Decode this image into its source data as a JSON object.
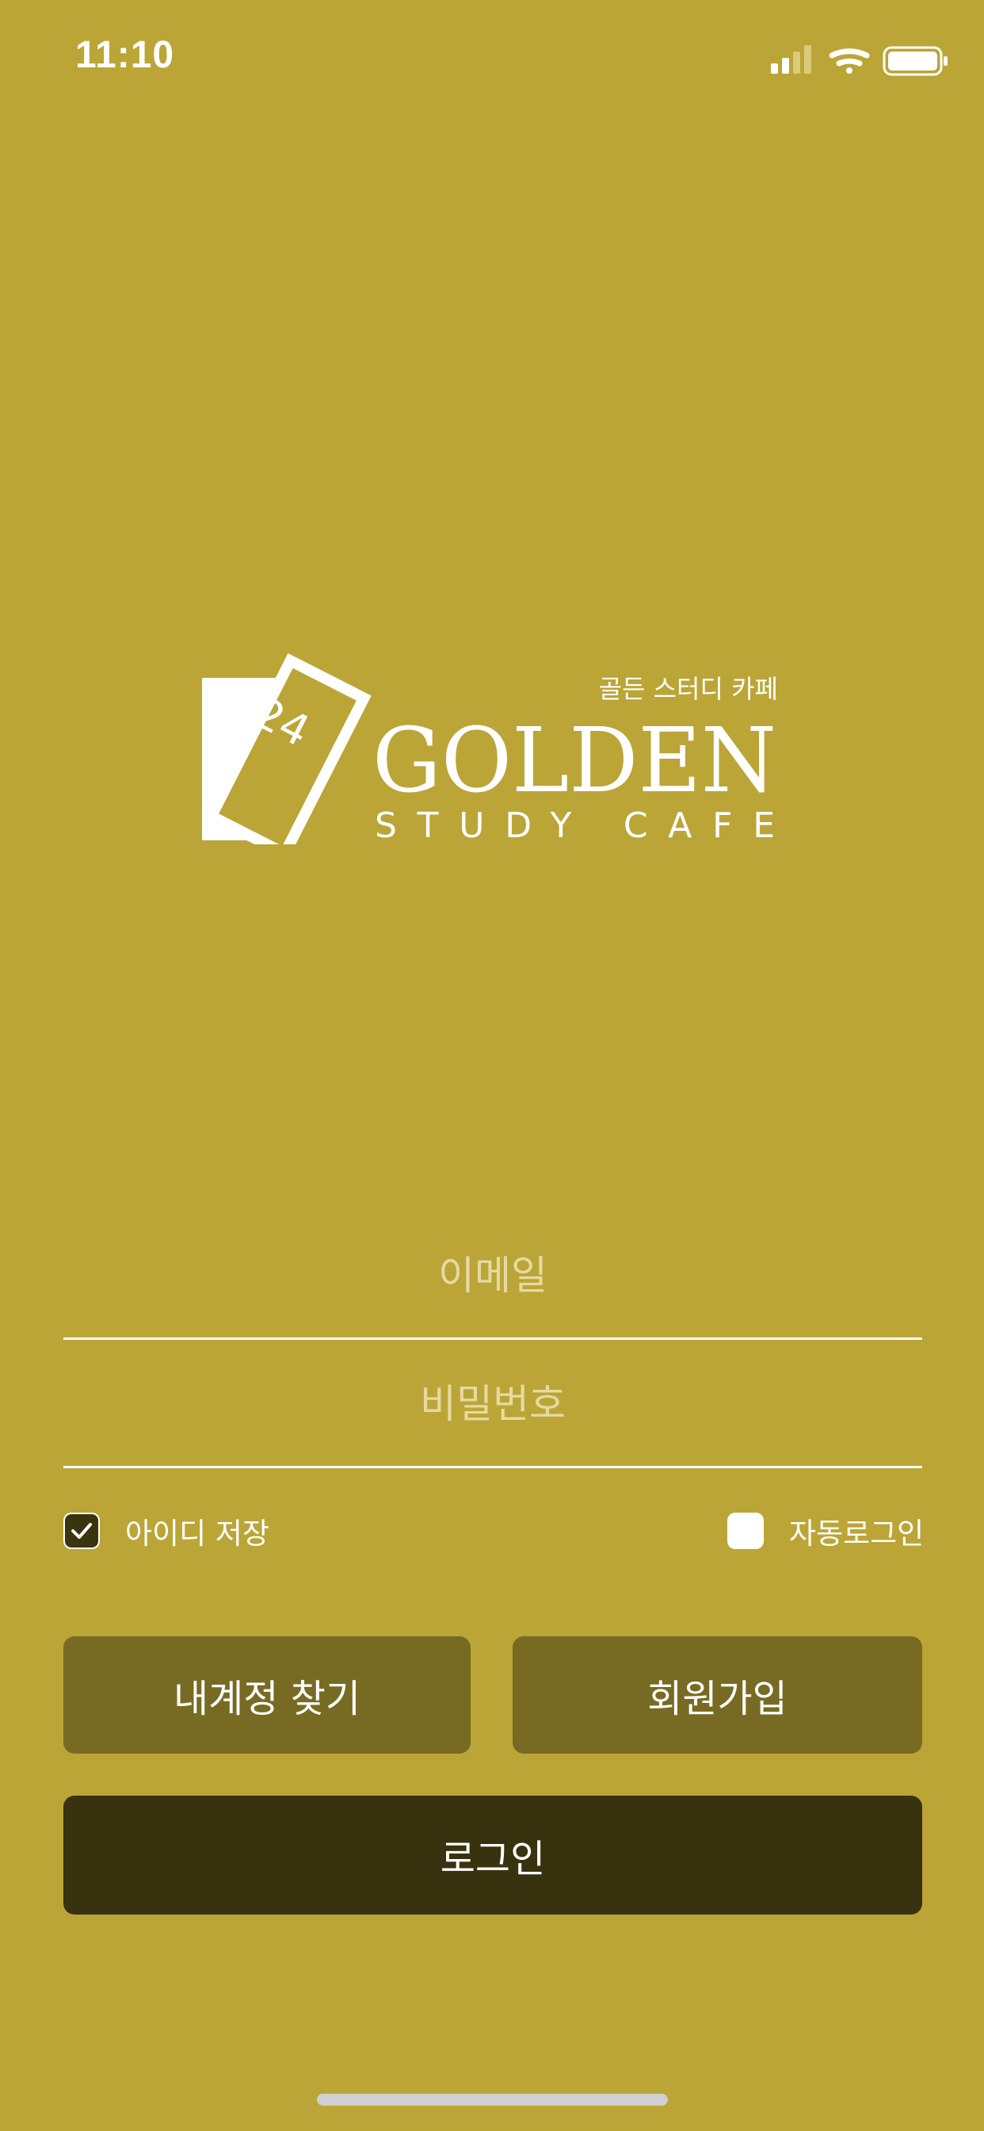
{
  "status_bar": {
    "time": "11:10",
    "icons": [
      "cellular-signal-icon",
      "wifi-icon",
      "battery-icon"
    ]
  },
  "logo": {
    "badge_number": "24",
    "korean_name": "골든 스터디 카페",
    "brand": "GOLDEN",
    "tagline": "STUDY CAFE"
  },
  "login_form": {
    "email_placeholder": "이메일",
    "email_value": "",
    "password_placeholder": "비밀번호",
    "password_value": "",
    "save_id": {
      "label": "아이디 저장",
      "checked": true
    },
    "auto_login": {
      "label": "자동로그인",
      "checked": false
    }
  },
  "buttons": {
    "find_account": "내계정 찾기",
    "sign_up": "회원가입",
    "login": "로그인"
  },
  "colors": {
    "background": "#BBA537",
    "secondary_button": "#776B24",
    "primary_button": "#39320E",
    "placeholder": "#E6D9A2"
  }
}
